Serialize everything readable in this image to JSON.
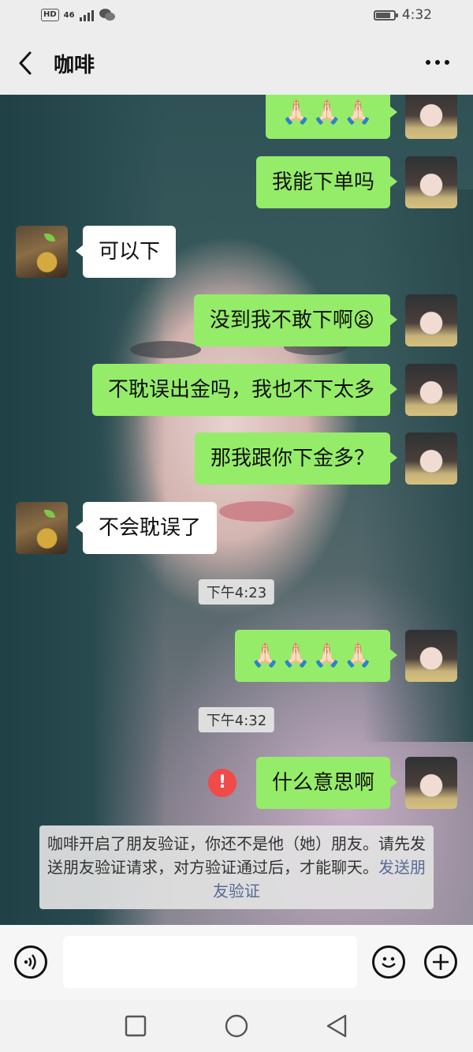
{
  "status_bar": {
    "hd": "HD",
    "network": "46",
    "time": "4:32"
  },
  "header": {
    "title": "咖啡"
  },
  "messages": [
    {
      "from": "me",
      "text": "🙏🏻🙏🏻🙏🏻"
    },
    {
      "from": "me",
      "text": "我能下单吗"
    },
    {
      "from": "them",
      "text": "可以下"
    },
    {
      "from": "me",
      "text": "没到我不敢下啊😫"
    },
    {
      "from": "me",
      "text": "不耽误出金吗，我也不下太多"
    },
    {
      "from": "me",
      "text": "那我跟你下金多？"
    },
    {
      "from": "them",
      "text": "不会耽误了"
    },
    {
      "from": "me",
      "text": "🙏🏻🙏🏻🙏🏻🙏🏻"
    },
    {
      "from": "me",
      "text": "什么意思啊"
    }
  ],
  "timestamps": [
    "下午4:23",
    "下午4:32"
  ],
  "send_failed_mark": "!",
  "notice": {
    "text": "咖啡开启了朋友验证，你还不是他（她）朋友。请先发送朋友验证请求，对方验证通过后，才能聊天。",
    "link": "发送朋友验证"
  },
  "icons": [
    "back-icon",
    "more-icon",
    "voice-icon",
    "emoji-icon",
    "add-icon",
    "recent-apps-icon",
    "home-icon",
    "back-nav-icon"
  ],
  "colors": {
    "my_bubble": "#95ec69",
    "their_bubble": "#ffffff",
    "link": "#576b95",
    "warn": "#f04a4a"
  }
}
